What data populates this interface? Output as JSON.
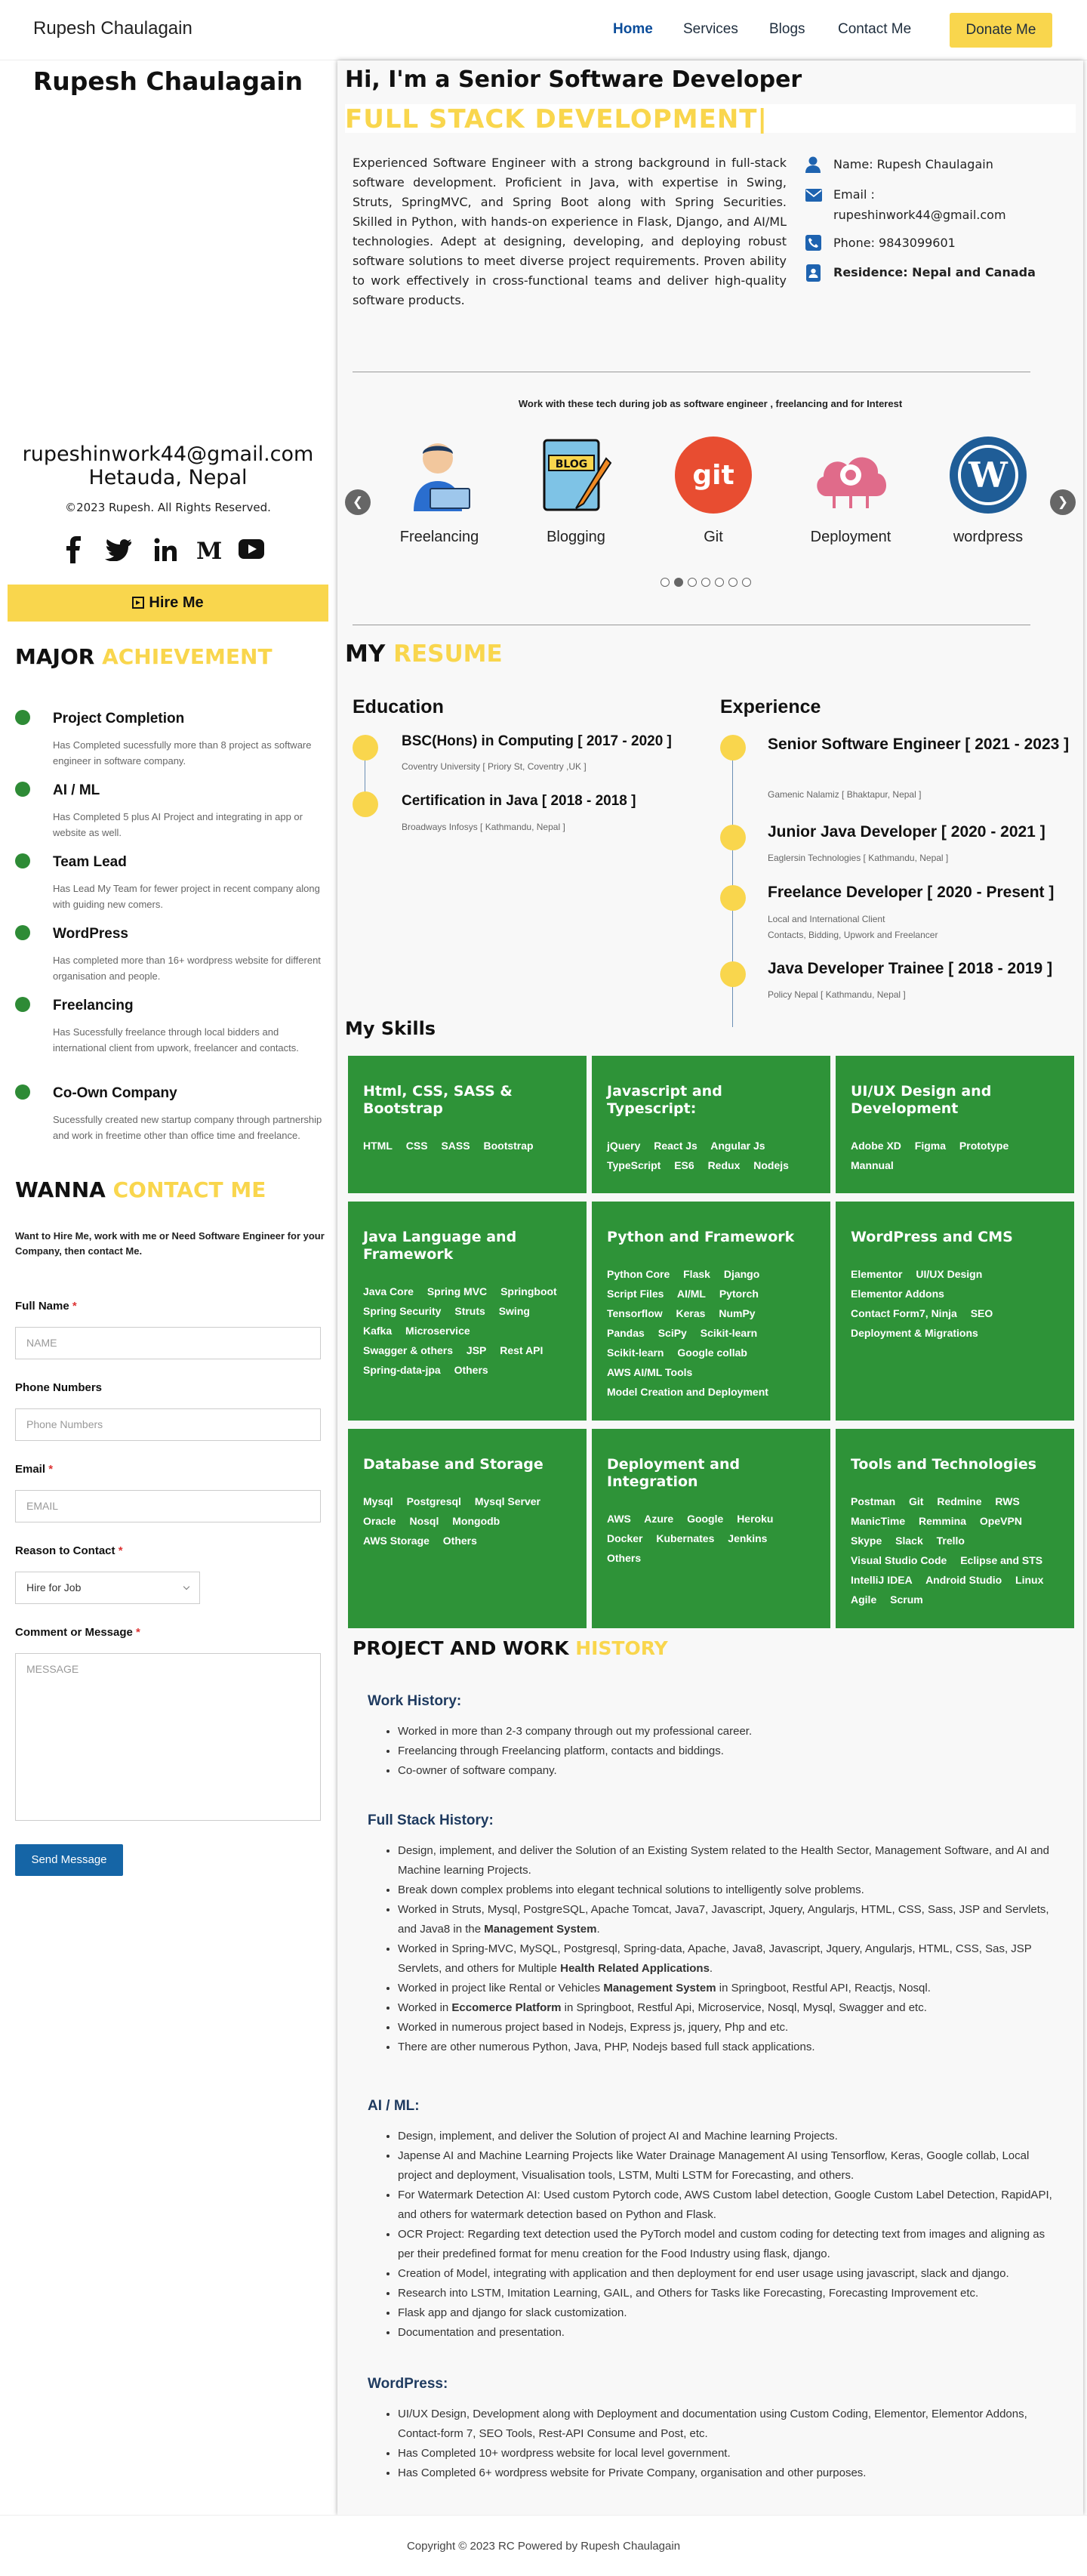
{
  "nav": {
    "brand": "Rupesh Chaulagain",
    "home": "Home",
    "services": "Services",
    "blogs": "Blogs",
    "contact": "Contact Me",
    "donate": "Donate Me"
  },
  "sidebar": {
    "name": "Rupesh Chaulagain",
    "email": "rupeshinwork44@gmail.com",
    "location": "Hetauda, Nepal",
    "copyright": "©2023 Rupesh. All Rights Reserved.",
    "social": [
      "facebook-icon",
      "twitter-icon",
      "linkedin-icon",
      "medium-icon",
      "youtube-icon"
    ],
    "hire": "Hire Me",
    "achievement_h1": "MAJOR ",
    "achievement_h2": "ACHIEVEMENT",
    "achievements": [
      {
        "title": "Project Completion",
        "desc": "Has Completed sucessfully more than 8 project as software engineer in software company."
      },
      {
        "title": "AI / ML",
        "desc": "Has Completed 5 plus AI Project and integrating in app or website as well."
      },
      {
        "title": "Team Lead",
        "desc": "Has Lead My Team for fewer project in recent company along with guiding new comers."
      },
      {
        "title": "WordPress",
        "desc": "Has completed more than 16+ wordpress website for different organisation and people."
      },
      {
        "title": "Freelancing",
        "desc": "Has Sucessfully freelance through local bidders and international client from upwork, freelancer and contacts."
      },
      {
        "title": "Co-Own Company",
        "desc": "Sucessfully created new startup company through partnership and work in freetime other than office time and freelance."
      }
    ],
    "wanna_h1": "WANNA ",
    "wanna_h2": "CONTACT ME",
    "wanna_intro": "Want to Hire Me, work with me or Need Software Engineer for your Company, then contact Me.",
    "form": {
      "name_label": "Full Name",
      "name_ph": "NAME",
      "phone_label": "Phone Numbers",
      "phone_ph": "Phone Numbers",
      "email_label": "Email",
      "email_ph": "EMAIL",
      "reason_label": "Reason to Contact",
      "reason_value": "Hire for Job",
      "msg_label": "Comment or Message",
      "msg_ph": "MESSAGE",
      "send": "Send Message",
      "required_mark": "*"
    }
  },
  "hero": {
    "title": "Hi, I'm a Senior Software Developer",
    "typing": "FULL STACK DEVELOPMENT|",
    "bio": "Experienced Software Engineer with a strong background in full-stack software development. Proficient in Java, with expertise in Swing, Struts, SpringMVC, and Spring Boot along with Spring Securities. Skilled in Python, with hands-on experience in Flask, Django, and AI/ML technologies. Adept at designing, developing, and deploying robust software solutions to meet diverse project requirements. Proven ability to work effectively in cross-functional teams and deliver high-quality software products.",
    "name_label": "Name: Rupesh Chaulagain",
    "email_label": "Email :",
    "email_value": "rupeshinwork44@gmail.com",
    "phone_label": "Phone: 9843099601",
    "residence_label": "Residence: Nepal and Canada"
  },
  "techs": {
    "caption": "Work with these tech during job as software engineer , freelancing and for Interest",
    "items": [
      "Freelancing",
      "Blogging",
      "Git",
      "Deployment",
      "wordpress"
    ],
    "blog_word": "BLOG",
    "git_word": "git",
    "prev": "❮",
    "next": "❯"
  },
  "resume": {
    "h1": "MY ",
    "h2": "RESUME",
    "education_h": "Education",
    "education": [
      {
        "title": "BSC(Hons) in Computing [ 2017 - 2020 ]",
        "sub": "Coventry University [ Priory St, Coventry ,UK ]"
      },
      {
        "title": "Certification in Java [ 2018 - 2018 ]",
        "sub": "Broadways Infosys [ Kathmandu, Nepal ]"
      }
    ],
    "experience_h": "Experience",
    "experience": [
      {
        "title": "Senior Software Engineer [ 2021 - 2023 ]",
        "sub": "Gamenic Nalamiz [ Bhaktapur, Nepal ]"
      },
      {
        "title": "Junior Java Developer [ 2020 - 2021 ]",
        "sub": "Eaglersin Technologies [ Kathmandu, Nepal ]"
      },
      {
        "title": "Freelance Developer [ 2020 - Present ]",
        "sub": "Local and International Client",
        "sub2": "Contacts, Bidding, Upwork and Freelancer"
      },
      {
        "title": "Java Developer Trainee [ 2018 - 2019 ]",
        "sub": "Policy Nepal [ Kathmandu, Nepal ]"
      }
    ]
  },
  "skills": {
    "heading": "My Skills",
    "cards": [
      {
        "title": "Html, CSS, SASS & Bootstrap",
        "tags": [
          "HTML",
          "CSS",
          "SASS",
          "Bootstrap"
        ]
      },
      {
        "title": "Javascript and Typescript:",
        "tags": [
          "jQuery",
          "React Js",
          "Angular Js",
          "TypeScript",
          "ES6",
          "Redux",
          "Nodejs"
        ]
      },
      {
        "title": "UI/UX Design and Development",
        "tags": [
          "Adobe XD",
          "Figma",
          "Prototype",
          "Mannual"
        ]
      },
      {
        "title": "Java Language and Framework",
        "tags": [
          "Java Core",
          "Spring MVC",
          "Springboot",
          "Spring Security",
          "Struts",
          "Swing",
          "Kafka",
          "Microservice",
          "Swagger & others",
          "JSP",
          "Rest API",
          "Spring-data-jpa",
          "Others"
        ]
      },
      {
        "title": "Python and Framework",
        "tags": [
          "Python Core",
          "Flask",
          "Django",
          "Script Files",
          "AI/ML",
          "Pytorch",
          "Tensorflow",
          "Keras",
          "NumPy",
          "Pandas",
          "SciPy",
          "Scikit-learn",
          "Scikit-learn",
          "Google collab",
          "AWS AI/ML Tools",
          "Model Creation and Deployment"
        ]
      },
      {
        "title": "WordPress and CMS",
        "tags": [
          "Elementor",
          "UI/UX Design",
          "Elementor Addons",
          "Contact Form7, Ninja",
          "SEO",
          "Deployment & Migrations"
        ]
      },
      {
        "title": "Database and Storage",
        "tags": [
          "Mysql",
          "Postgresql",
          "Mysql Server",
          "Oracle",
          "Nosql",
          "Mongodb",
          "AWS Storage",
          "Others"
        ]
      },
      {
        "title": "Deployment and Integration",
        "tags": [
          "AWS",
          "Azure",
          "Google",
          "Heroku",
          "Docker",
          "Kubernates",
          "Jenkins",
          "Others"
        ]
      },
      {
        "title": "Tools and Technologies",
        "tags": [
          "Postman",
          "Git",
          "Redmine",
          "RWS",
          "ManicTime",
          "Remmina",
          "OpeVPN",
          "Skype",
          "Slack",
          "Trello",
          "Visual Studio Code",
          "Eclipse and STS",
          "IntelliJ IDEA",
          "Android Studio",
          "Linux",
          "Agile",
          "Scrum"
        ]
      }
    ]
  },
  "projects": {
    "h1": "PROJECT AND WORK ",
    "h2": "HISTORY",
    "work_h": "Work History:",
    "work": [
      "Worked in more than 2-3 company through out my professional career.",
      "Freelancing through Freelancing platform, contacts and biddings.",
      "Co-owner of software company."
    ],
    "fullstack_h": "Full Stack History:",
    "fullstack": [
      "Design, implement, and deliver the Solution of an Existing System related to the Health Sector, Management Software, and AI and Machine learning Projects.",
      "Break down complex problems into elegant technical solutions to intelligently solve problems.",
      "Worked in Struts, Mysql, PostgreSQL, Apache Tomcat, Java7, Javascript, Jquery, Angularjs, HTML, CSS, Sass, JSP and Servlets, and Java8 in the Management System.",
      "Worked in Spring-MVC, MySQL, Postgresql, Spring-data, Apache, Java8, Javascript, Jquery, Angularjs, HTML, CSS, Sas, JSP Servlets, and others for  Multiple Health Related Applications.",
      "Worked in project like Rental or Vehicles Management System in Springboot, Restful API, Reactjs, Nosql.",
      "Worked in Eccomerce Platform  in Springboot, Restful Api, Microservice, Nosql, Mysql, Swagger and etc.",
      "Worked in numerous project based in Nodejs, Express js, jquery, Php and etc.",
      " There are other numerous Python, Java, PHP, Nodejs based full stack applications."
    ],
    "ai_h": "AI / ML:",
    "ai": [
      "Design, implement, and deliver the Solution of project AI and Machine learning Projects.",
      "Japense AI and Machine Learning Projects like Water Drainage Management AI using Tensorflow, Keras, Google collab, Local project and deployment, Visualisation tools, LSTM, Multi LSTM for Forecasting, and others.",
      "For Watermark Detection AI: Used custom Pytorch code, AWS Custom label detection, Google Custom Label Detection, RapidAPI, and others for watermark detection based on Python and Flask.",
      "OCR Project: Regarding text detection used the PyTorch model and custom coding for detecting text from images and aligning as per their predefined format for menu creation for the Food Industry using flask, django.",
      "Creation of Model, integrating with application and then deployment for end user usage using javascript, slack and django.",
      "Research into LSTM, Imitation Learning, GAIL, and Others for Tasks like Forecasting, Forecasting Improvement etc.",
      "Flask app and django for slack customization.",
      "Documentation and presentation."
    ],
    "wp_h": "WordPress:",
    "wp": [
      "UI/UX Design, Development along with Deployment and documentation using Custom Coding, Elementor, Elementor Addons, Contact-form 7, SEO Tools, Rest-API Consume and Post, etc.",
      "Has Completed 10+ wordpress website for local level government.",
      "Has Completed 6+ wordpress website for Private Company, organisation and other purposes."
    ]
  },
  "footer": {
    "text": "Copyright © 2023 RC Powered by Rupesh Chaulagain"
  },
  "colors": {
    "accent": "#f9d64d",
    "green": "#2e9338",
    "link": "#0066aa",
    "button": "#1565a6"
  }
}
